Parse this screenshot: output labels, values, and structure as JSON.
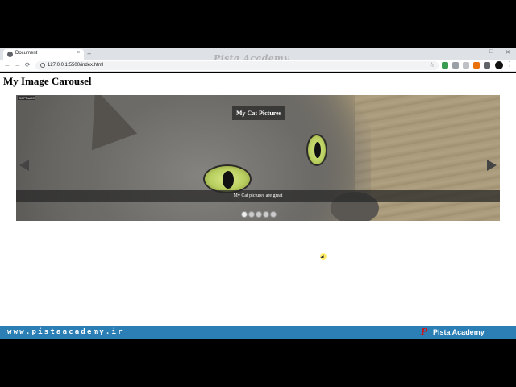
{
  "browser": {
    "tab_title": "Document",
    "tab_close": "×",
    "new_tab": "+",
    "url": "127.0.0.1:5500/index.html",
    "star": "☆",
    "menu": "⋮",
    "back": "←",
    "forward": "→",
    "reload": "⟳",
    "win_minimize": "–",
    "win_maximize": "□",
    "win_close": "✕"
  },
  "watermark": "Pista Academy",
  "page": {
    "title": "My Image Carousel"
  },
  "carousel": {
    "camera_label": "GOPR●HC",
    "heading": "My Cat Pictures",
    "caption": "My Cat pictures are great",
    "slide_count": 5,
    "active_slide": 1
  },
  "footer": {
    "url": "www.pistaacademy.ir",
    "logo": "P",
    "name": "Pista Academy",
    "background": "#2b7fb5"
  }
}
